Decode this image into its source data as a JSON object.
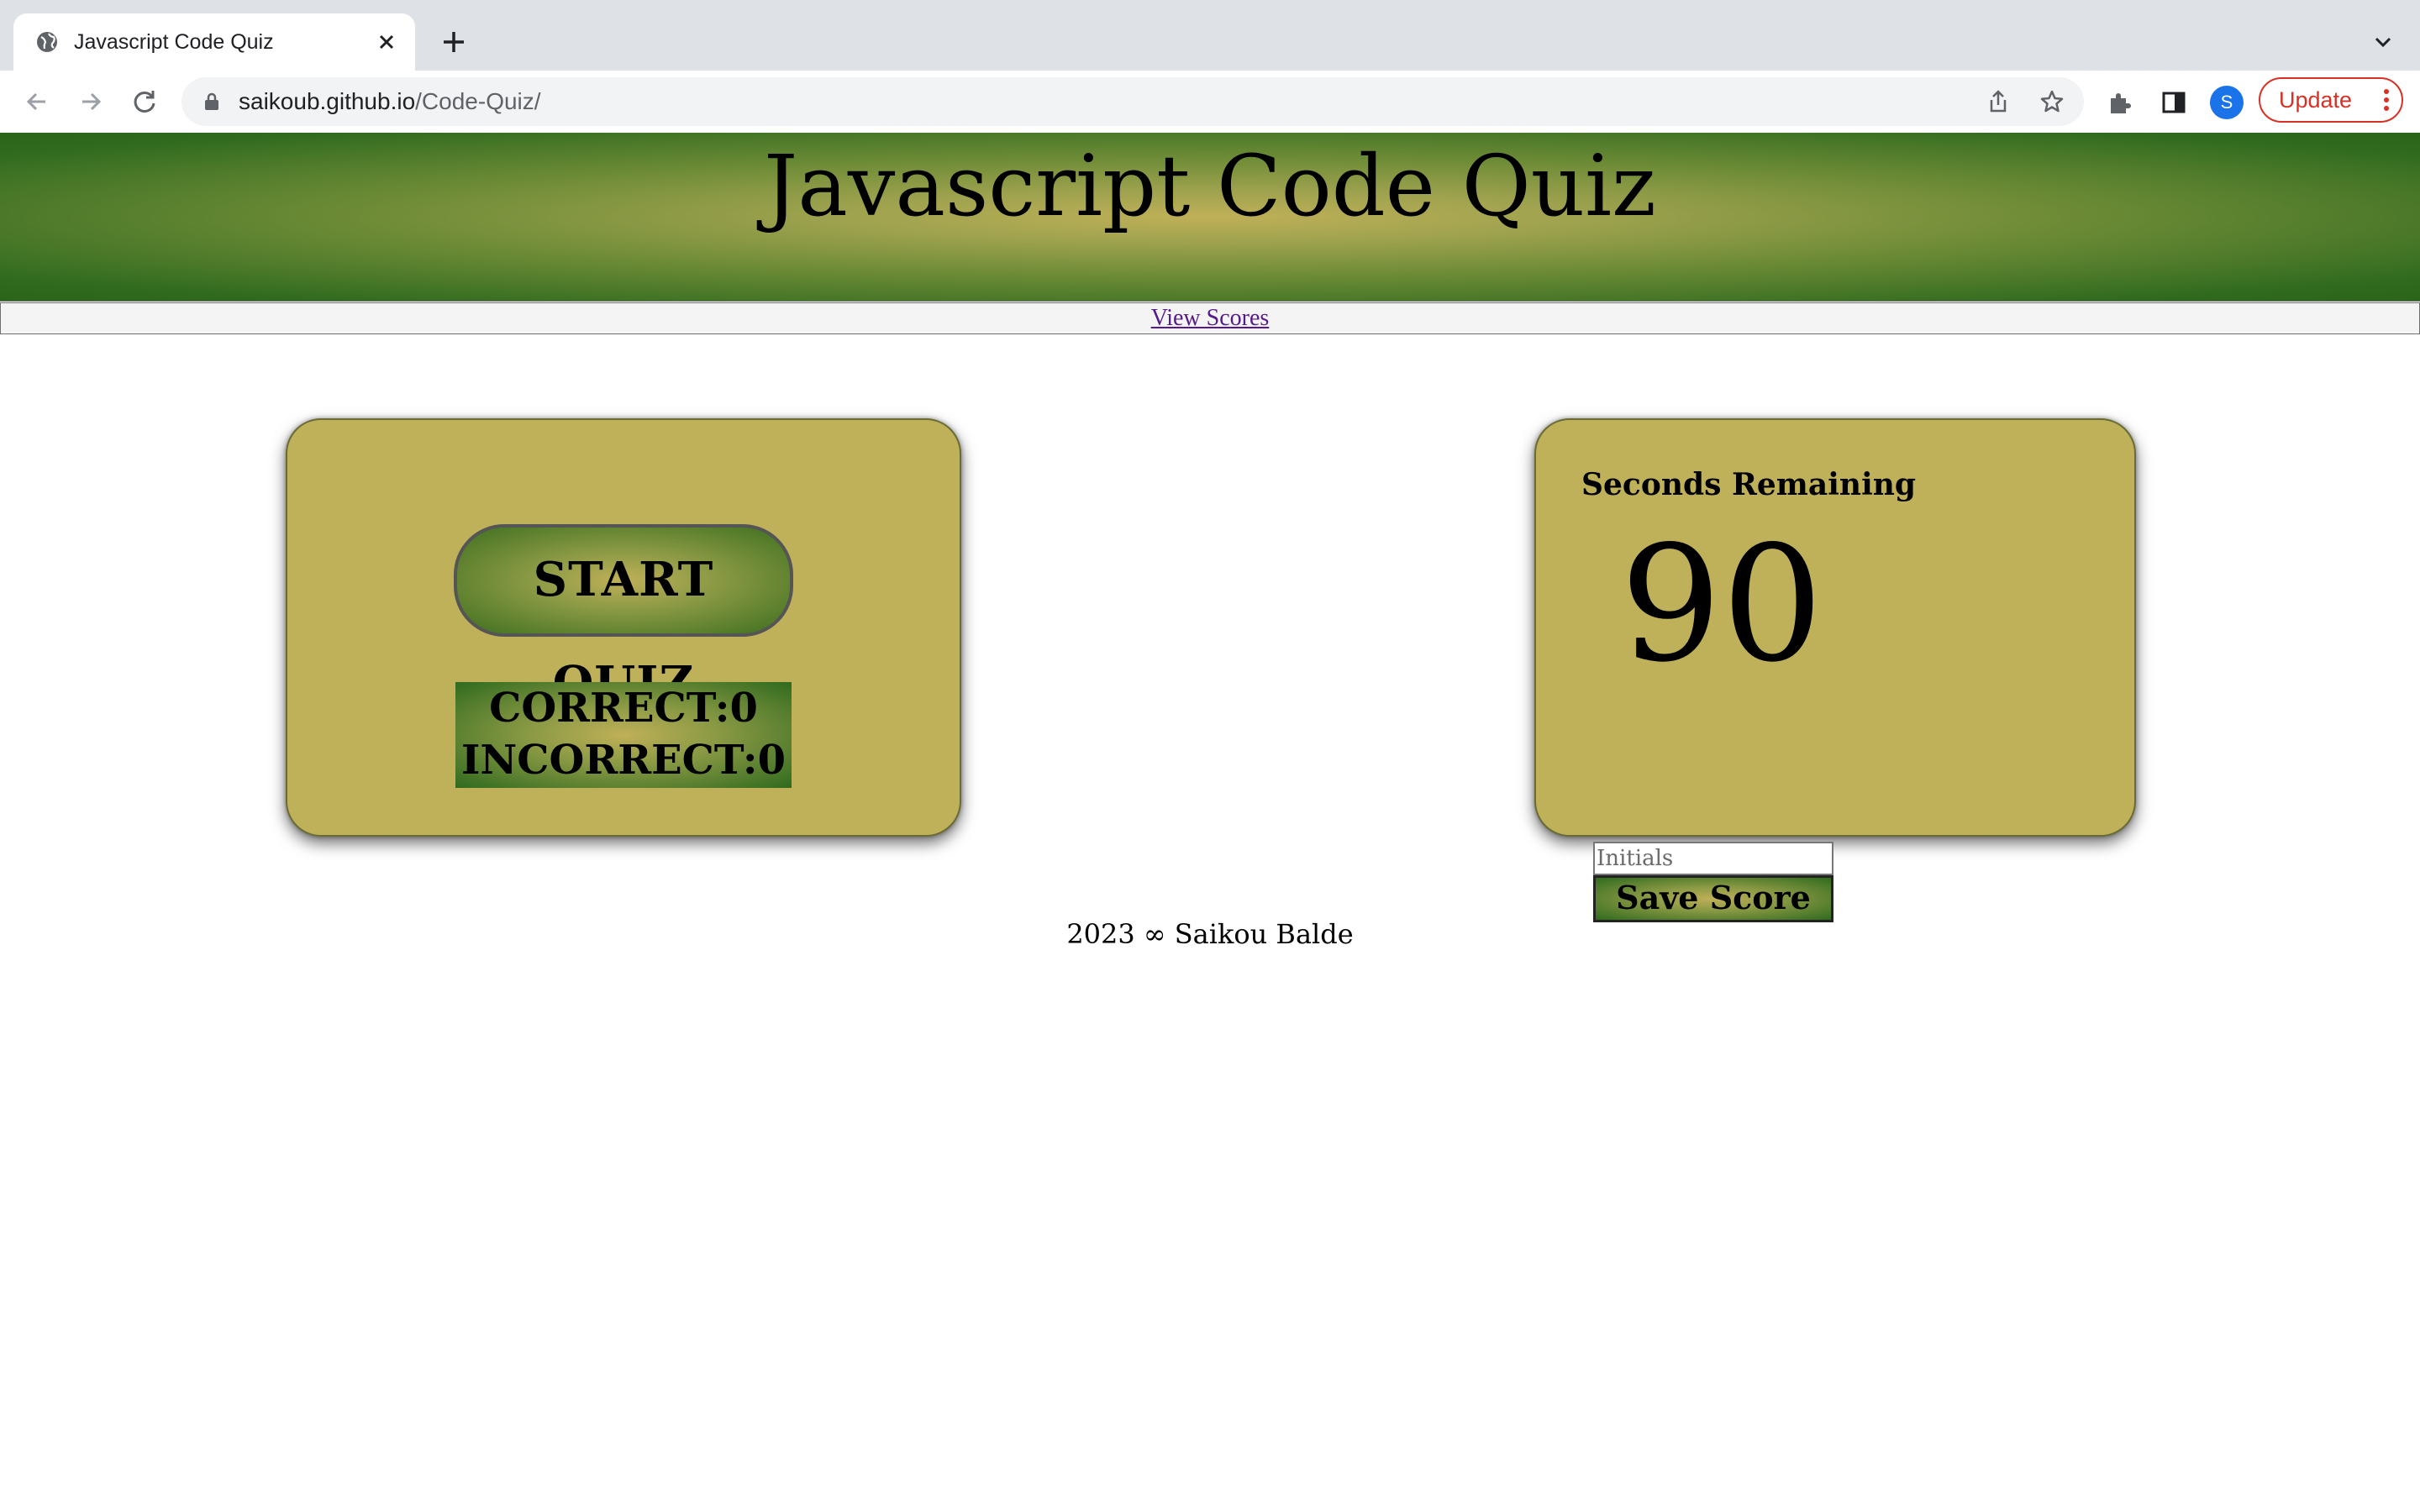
{
  "browser": {
    "tab_title": "Javascript Code Quiz",
    "url_host": "saikoub.github.io",
    "url_path": "/Code-Quiz/",
    "profile_initial": "S",
    "update_label": "Update"
  },
  "page": {
    "header_title": "Javascript Code Quiz",
    "nav_link": "View Scores",
    "start_button": "START QUIZ",
    "correct_label": "CORRECT:0",
    "incorrect_label": "INCORRECT:0",
    "timer_label": "Seconds Remaining",
    "timer_value": "90",
    "initials_placeholder": "Initials",
    "save_button": "Save Score",
    "footer": "2023 ∞ Saikou Balde"
  },
  "colors": {
    "card_bg": "#bfb159",
    "banner_center": "#bfb058",
    "banner_edge": "#2a6519",
    "update_red": "#d93025",
    "link": "#551a8b"
  }
}
